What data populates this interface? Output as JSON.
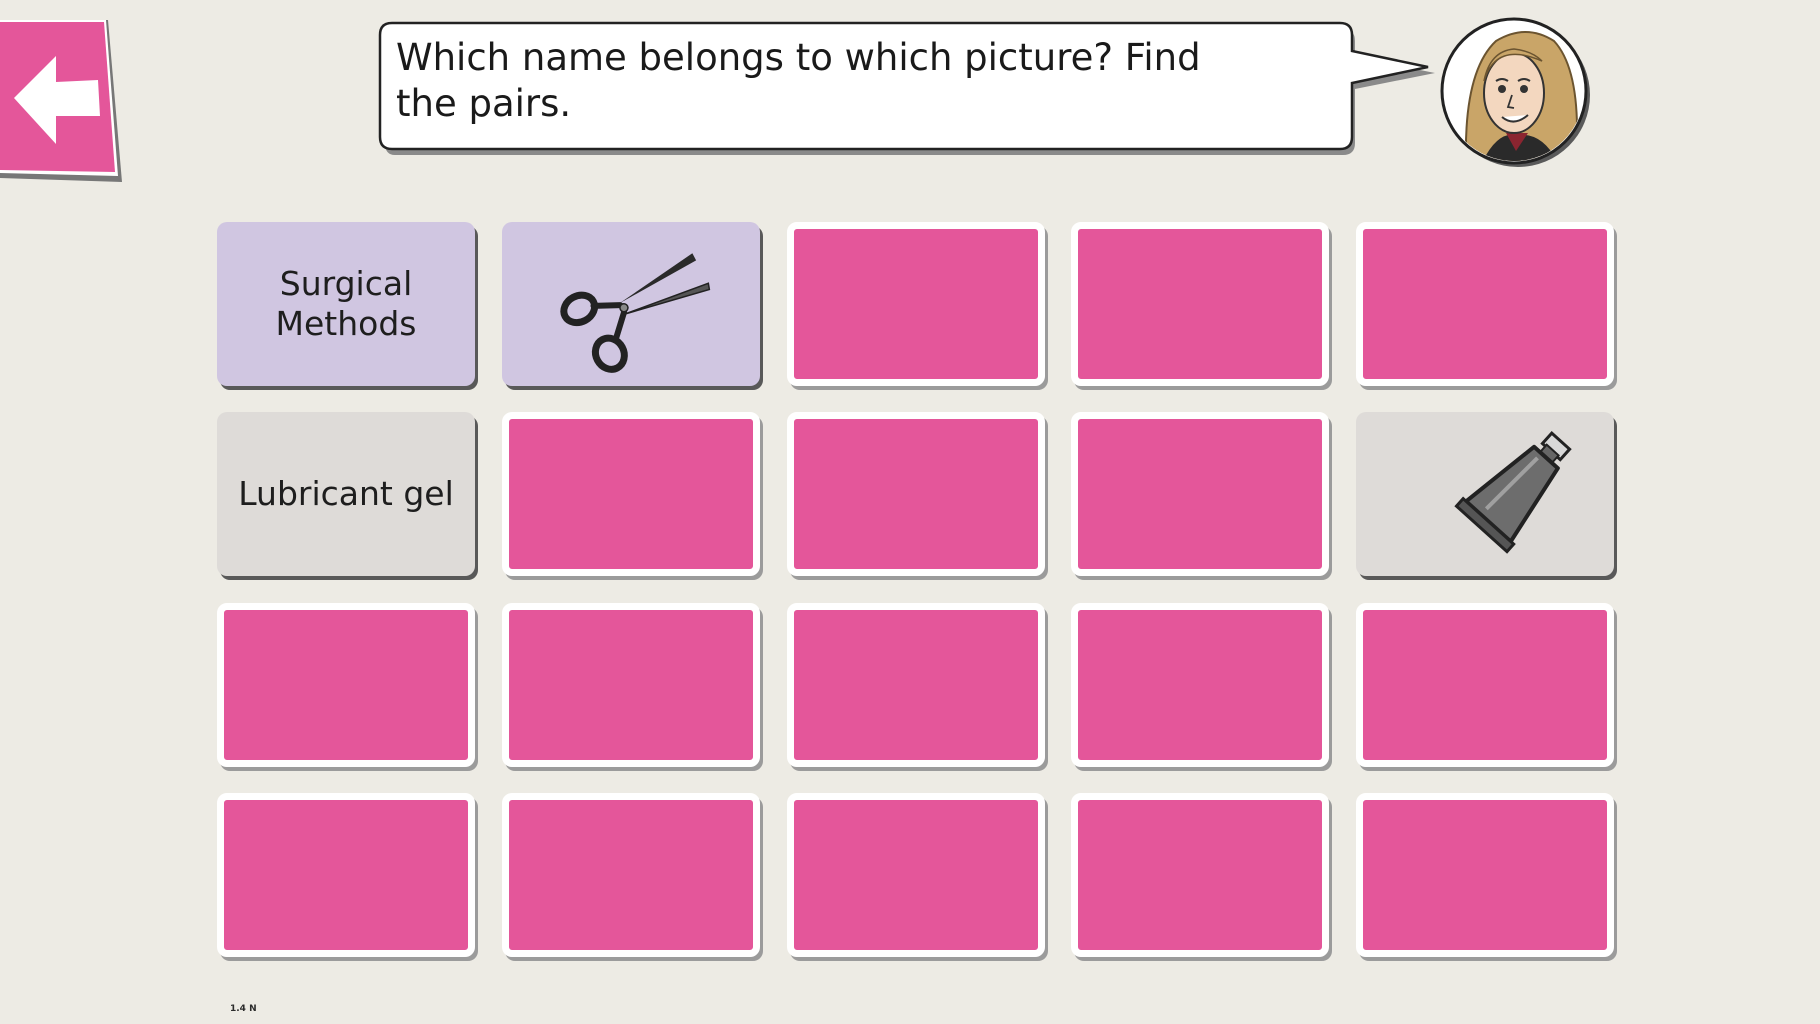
{
  "instruction": {
    "text": "Which name belongs to which picture? Find the pairs."
  },
  "navigation": {
    "back_icon": "left-arrow-icon"
  },
  "colors": {
    "background": "#edebe4",
    "card_back": "#e4569a",
    "card_lilac": "#d0c6e1",
    "card_grey": "#dedbd8",
    "back_button": "#e4569a"
  },
  "board": {
    "rows": 4,
    "columns": 5,
    "revealed_cards": [
      {
        "row": 1,
        "col": 1,
        "type": "text",
        "label": "Surgical Methods",
        "color": "lilac"
      },
      {
        "row": 1,
        "col": 2,
        "type": "picture",
        "icon": "scissors-icon",
        "color": "lilac"
      },
      {
        "row": 2,
        "col": 1,
        "type": "text",
        "label": "Lubricant gel",
        "color": "grey"
      },
      {
        "row": 2,
        "col": 5,
        "type": "picture",
        "icon": "lubricant-tube-icon",
        "color": "grey"
      }
    ]
  },
  "footer": {
    "version": "1.4 N"
  }
}
